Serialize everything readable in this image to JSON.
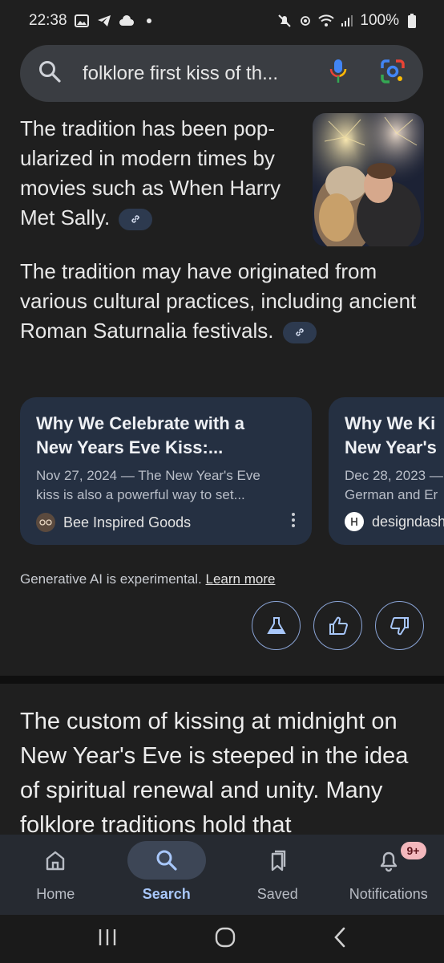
{
  "status_bar": {
    "time": "22:38",
    "battery": "100%",
    "left_icons": [
      "image-icon",
      "telegram-icon",
      "cloud-icon",
      "dot-icon"
    ],
    "right_icons": [
      "mute-icon",
      "hotspot-icon",
      "wifi-icon",
      "signal-icon",
      "battery-icon"
    ]
  },
  "search": {
    "query": "folklore first kiss of th..."
  },
  "overview": {
    "para1": "The tradition has been pop-ularized in modern times by movies such as When Harry Met Sally.",
    "para2": "The tradition may have originated from various cultural practices, including ancient Roman Saturnalia festivals."
  },
  "cards": [
    {
      "title_line1": "Why We Celebrate with a",
      "title_line2": "New Years Eve Kiss:...",
      "snippet_line1": "Nov 27, 2024 — The New Year's Eve",
      "snippet_line2": "kiss is also a powerful way to set...",
      "source": "Bee Inspired Goods"
    },
    {
      "title_line1": "Why We Ki",
      "title_line2": "New Year's",
      "snippet_line1": "Dec 28, 2023 —",
      "snippet_line2": "German and Er",
      "source": "designdash"
    }
  ],
  "disclaimer": {
    "text": "Generative AI is experimental.",
    "link": "Learn more"
  },
  "feedback": [
    "flask-icon",
    "thumbs-up-icon",
    "thumbs-down-icon"
  ],
  "result_text": "The custom of kissing at midnight on New Year's Eve is steeped in the idea of spiritual renewal and unity. Many folklore traditions hold that",
  "nav": {
    "items": [
      {
        "label": "Home",
        "icon": "home-icon"
      },
      {
        "label": "Search",
        "icon": "search-icon"
      },
      {
        "label": "Saved",
        "icon": "bookmark-icon"
      },
      {
        "label": "Notifications",
        "icon": "bell-icon"
      }
    ],
    "active": "Search",
    "notification_badge": "9+"
  },
  "colors": {
    "background": "#1f1f1f",
    "accent": "#a8c7fa",
    "card": "#253042"
  }
}
